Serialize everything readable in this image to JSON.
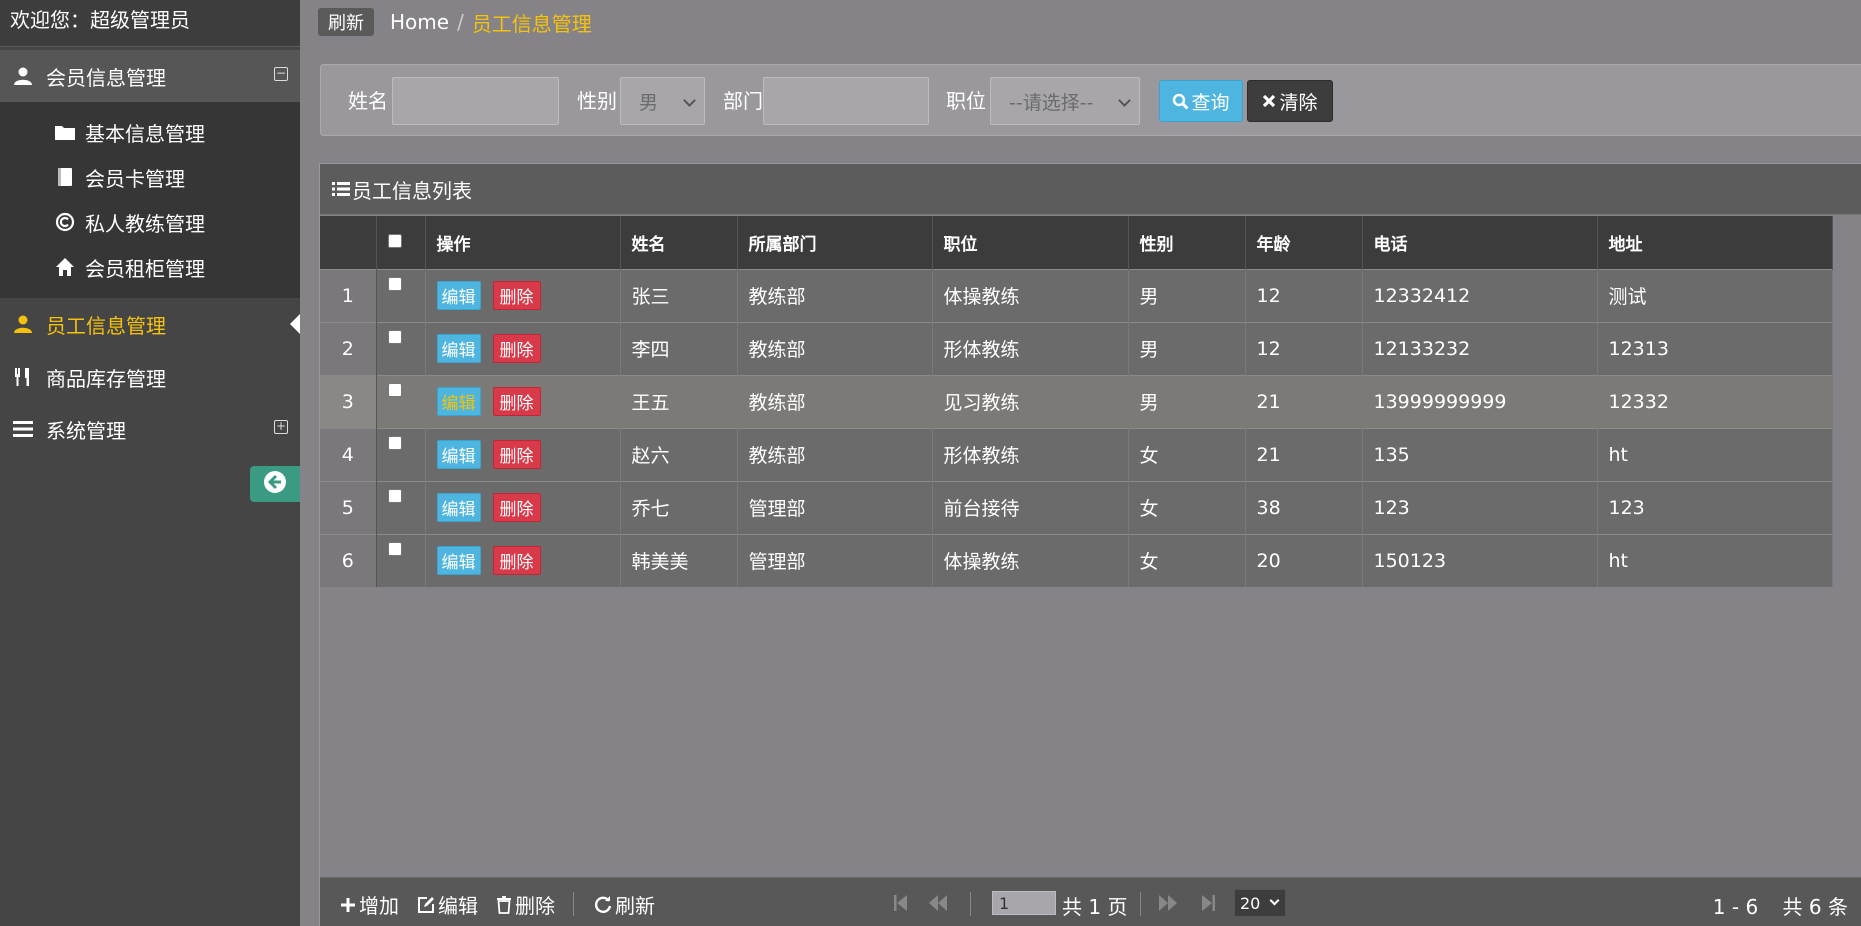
{
  "sidebar": {
    "welcome": "欢迎您：超级管理员",
    "member_menu": "会员信息管理",
    "member_items": [
      "基本信息管理",
      "会员卡管理",
      "私人教练管理",
      "会员租柜管理"
    ],
    "staff_menu": "员工信息管理",
    "goods_menu": "商品库存管理",
    "system_menu": "系统管理",
    "collapse_icon": "arrow-left-circle-icon"
  },
  "breadcrumb": {
    "refresh": "刷新",
    "home": "Home",
    "separator": "/",
    "current": "员工信息管理"
  },
  "search": {
    "name_label": "姓名",
    "name_value": "",
    "gender_label": "性别",
    "gender_value": "男",
    "dept_label": "部门",
    "dept_value": "",
    "position_label": "职位",
    "position_value": "--请选择--",
    "query_label": "查询",
    "clear_label": "清除"
  },
  "grid": {
    "title": "员工信息列表",
    "columns": [
      "操作",
      "姓名",
      "所属部门",
      "职位",
      "性别",
      "年龄",
      "电话",
      "地址"
    ],
    "edit_label": "编辑",
    "delete_label": "删除",
    "rows": [
      {
        "no": "1",
        "name": "张三",
        "dept": "教练部",
        "position": "体操教练",
        "gender": "男",
        "age": "12",
        "phone": "12332412",
        "address": "测试"
      },
      {
        "no": "2",
        "name": "李四",
        "dept": "教练部",
        "position": "形体教练",
        "gender": "男",
        "age": "12",
        "phone": "12133232",
        "address": "12313"
      },
      {
        "no": "3",
        "name": "王五",
        "dept": "教练部",
        "position": "见习教练",
        "gender": "男",
        "age": "21",
        "phone": "13999999999",
        "address": "12332"
      },
      {
        "no": "4",
        "name": "赵六",
        "dept": "教练部",
        "position": "形体教练",
        "gender": "女",
        "age": "21",
        "phone": "135",
        "address": "ht"
      },
      {
        "no": "5",
        "name": "乔七",
        "dept": "管理部",
        "position": "前台接待",
        "gender": "女",
        "age": "38",
        "phone": "123",
        "address": "123"
      },
      {
        "no": "6",
        "name": "韩美美",
        "dept": "管理部",
        "position": "体操教练",
        "gender": "女",
        "age": "20",
        "phone": "150123",
        "address": "ht"
      }
    ]
  },
  "pager": {
    "add": "增加",
    "edit": "编辑",
    "delete": "删除",
    "refresh": "刷新",
    "page_value": "1",
    "page_total": "共 1 页",
    "page_size": "20",
    "range": "1 - 6",
    "count": "共 6 条"
  },
  "colors": {
    "accent": "#f4c20d",
    "query_button": "#4db5e0",
    "delete_button": "#d93a4a",
    "collapse_button": "#3b9a82"
  }
}
